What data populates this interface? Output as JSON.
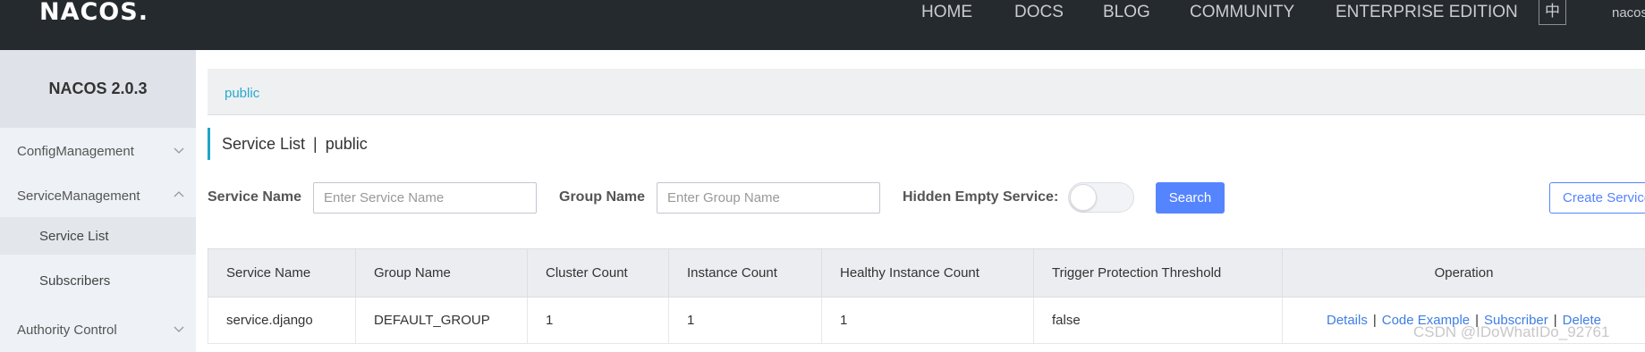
{
  "header": {
    "logo": "NACOS.",
    "nav": [
      "HOME",
      "DOCS",
      "BLOG",
      "COMMUNITY",
      "ENTERPRISE EDITION"
    ],
    "lang": "中",
    "user": "nacos"
  },
  "sidebar": {
    "title": "NACOS 2.0.3",
    "items": [
      {
        "label": "ConfigManagement",
        "expanded": false
      },
      {
        "label": "ServiceManagement",
        "expanded": true
      },
      {
        "label": "Service List",
        "active": true
      },
      {
        "label": "Subscribers"
      },
      {
        "label": "Authority Control",
        "expanded": false
      }
    ]
  },
  "namespace": {
    "current": "public"
  },
  "page": {
    "title": "Service List",
    "separator": "|",
    "namespace": "public"
  },
  "filters": {
    "service_name_label": "Service Name",
    "service_name_placeholder": "Enter Service Name",
    "service_name_value": "",
    "group_name_label": "Group Name",
    "group_name_placeholder": "Enter Group Name",
    "group_name_value": "",
    "hidden_empty_label": "Hidden Empty Service:",
    "hidden_empty_on": false,
    "search_label": "Search",
    "create_label": "Create Service"
  },
  "table": {
    "headers": [
      "Service Name",
      "Group Name",
      "Cluster Count",
      "Instance Count",
      "Healthy Instance Count",
      "Trigger Protection Threshold",
      "Operation"
    ],
    "rows": [
      {
        "cells": [
          "service.django",
          "DEFAULT_GROUP",
          "1",
          "1",
          "1",
          "false"
        ],
        "ops": [
          "Details",
          "Code Example",
          "Subscriber",
          "Delete"
        ]
      }
    ],
    "op_separator": "|"
  },
  "watermark": "CSDN @IDoWhatIDo_92761",
  "colors": {
    "topbar": "#252a2f",
    "accent": "#5584ff",
    "link": "#29a8cc"
  }
}
